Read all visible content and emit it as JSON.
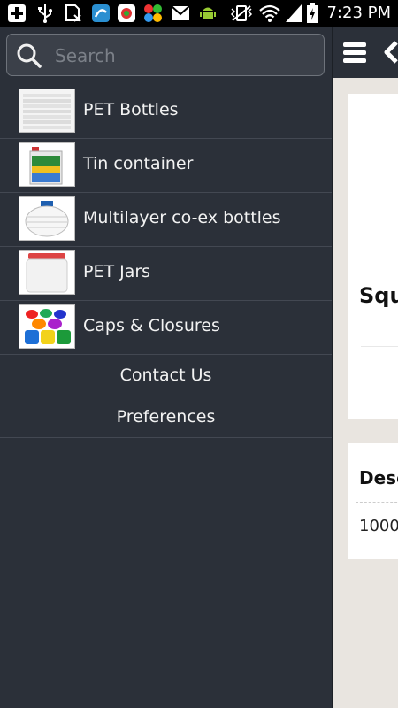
{
  "status_bar": {
    "time": "7:23 PM",
    "icons": [
      "add-icon",
      "usb-icon",
      "sim-blocked-icon",
      "app-icon-1",
      "app-icon-2",
      "app-icon-3",
      "gmail-icon",
      "android-icon",
      "vibrate-mute-icon",
      "wifi-icon",
      "signal-icon",
      "battery-charging-icon"
    ]
  },
  "drawer": {
    "search_placeholder": "Search",
    "items": [
      {
        "label": "PET Bottles",
        "icon": "pet-bottles-thumbnail"
      },
      {
        "label": "Tin container",
        "icon": "tin-container-thumbnail"
      },
      {
        "label": "Multilayer co-ex bottles",
        "icon": "multilayer-bottle-thumbnail"
      },
      {
        "label": "PET Jars",
        "icon": "pet-jar-thumbnail"
      },
      {
        "label": "Caps & Closures",
        "icon": "caps-thumbnail"
      }
    ],
    "contact_label": "Contact Us",
    "preferences_label": "Preferences"
  },
  "content": {
    "card1_heading": "Squ",
    "card2_heading": "Desc",
    "card2_value": "1000"
  },
  "colors": {
    "drawer_bg": "#2b3039",
    "content_bg": "#e9e5e0",
    "divider": "#434852"
  }
}
